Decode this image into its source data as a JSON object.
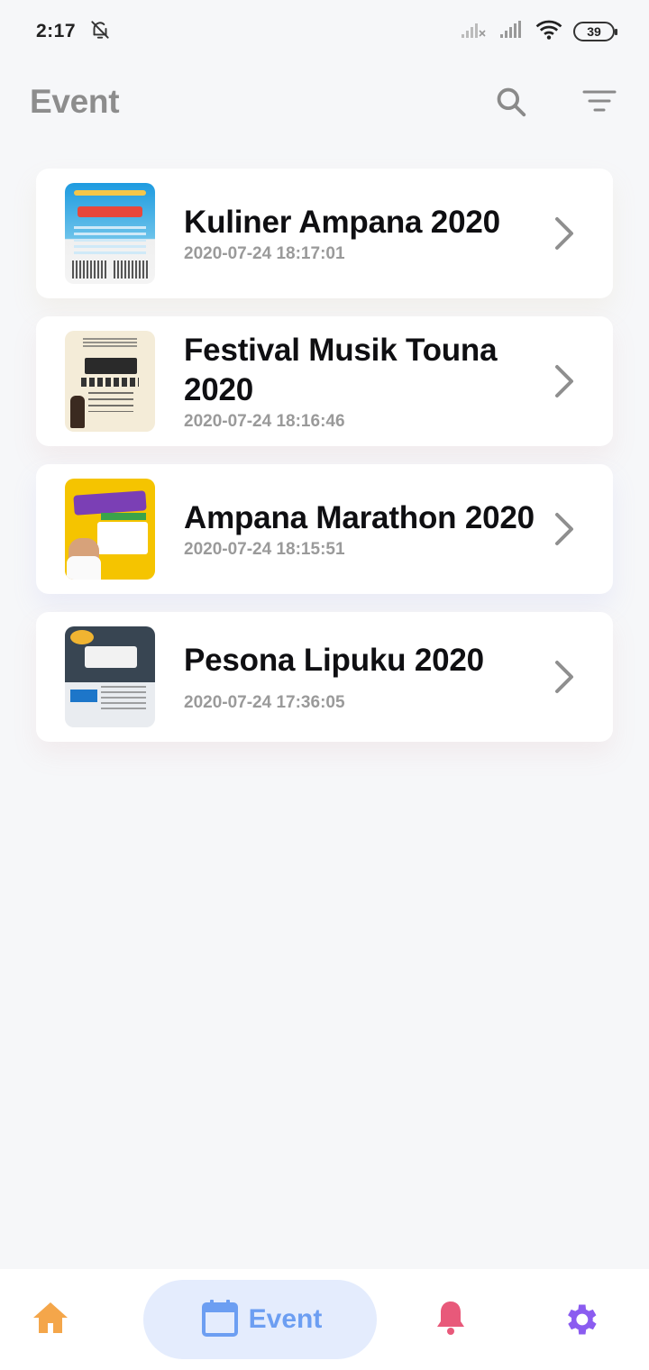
{
  "status_bar": {
    "time": "2:17",
    "battery": "39",
    "icons": [
      "bell-off-icon",
      "signal-x-icon",
      "signal-icon",
      "wifi-icon",
      "battery-icon"
    ]
  },
  "app_bar": {
    "title": "Event",
    "actions": [
      "search-icon",
      "filter-icon"
    ]
  },
  "events": [
    {
      "title": "Kuliner Ampana 2020",
      "date": "2020-07-24 18:17:01"
    },
    {
      "title": "Festival Musik Touna 2020",
      "date": "2020-07-24 18:16:46"
    },
    {
      "title": "Ampana Marathon 2020",
      "date": "2020-07-24 18:15:51"
    },
    {
      "title": "Pesona Lipuku 2020",
      "date": "2020-07-24 17:36:05"
    }
  ],
  "bottom_nav": {
    "items": [
      {
        "icon": "home-icon",
        "label": ""
      },
      {
        "icon": "calendar-icon",
        "label": "Event",
        "active": true
      },
      {
        "icon": "bell-icon",
        "label": ""
      },
      {
        "icon": "gear-icon",
        "label": ""
      }
    ]
  },
  "colors": {
    "background": "#f6f7f9",
    "home": "#f4a64a",
    "event_accent": "#6c9ef2",
    "event_pill": "#e4ecfd",
    "bell": "#e8597a",
    "settings": "#8b5cf0"
  }
}
